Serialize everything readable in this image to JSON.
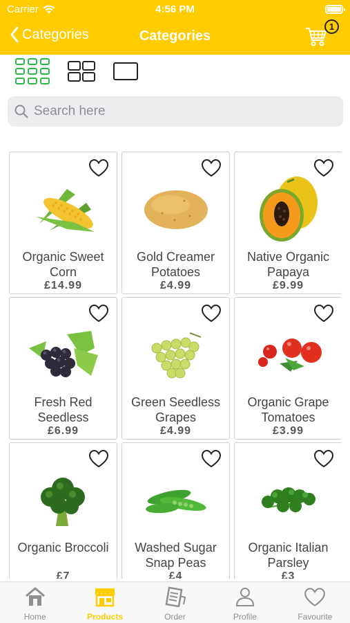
{
  "status": {
    "carrier": "Carrier",
    "time": "4:56 PM"
  },
  "nav": {
    "back_label": "Categories",
    "title": "Categories",
    "cart_count": "1"
  },
  "search": {
    "placeholder": "Search here",
    "value": ""
  },
  "products": [
    {
      "name": "Organic Sweet Corn",
      "price": "£14.99",
      "image": "corn"
    },
    {
      "name": "Gold Creamer Potatoes",
      "price": "£4.99",
      "image": "potato"
    },
    {
      "name": "Native Organic Papaya",
      "price": "£9.99",
      "image": "papaya"
    },
    {
      "name": "Fresh Red Seedless",
      "price": "£6.99",
      "image": "red-grapes"
    },
    {
      "name": "Green Seedless Grapes",
      "price": "£4.99",
      "image": "green-grapes"
    },
    {
      "name": "Organic Grape Tomatoes",
      "price": "£3.99",
      "image": "tomatoes"
    },
    {
      "name": "Organic Broccoli",
      "price": "£7",
      "image": "broccoli"
    },
    {
      "name": "Washed Sugar Snap Peas",
      "price": "£4",
      "image": "peas"
    },
    {
      "name": "Organic Italian Parsley",
      "price": "£3",
      "image": "parsley"
    }
  ],
  "tabs": [
    {
      "label": "Home",
      "icon": "home-icon",
      "active": false
    },
    {
      "label": "Products",
      "icon": "store-icon",
      "active": true
    },
    {
      "label": "Order",
      "icon": "receipt-icon",
      "active": false
    },
    {
      "label": "Profile",
      "icon": "person-icon",
      "active": false
    },
    {
      "label": "Favourite",
      "icon": "heart-icon",
      "active": false
    }
  ],
  "colors": {
    "accent": "#FFCC00",
    "grid_active": "#2EB84B",
    "inactive": "#8E8E93"
  }
}
